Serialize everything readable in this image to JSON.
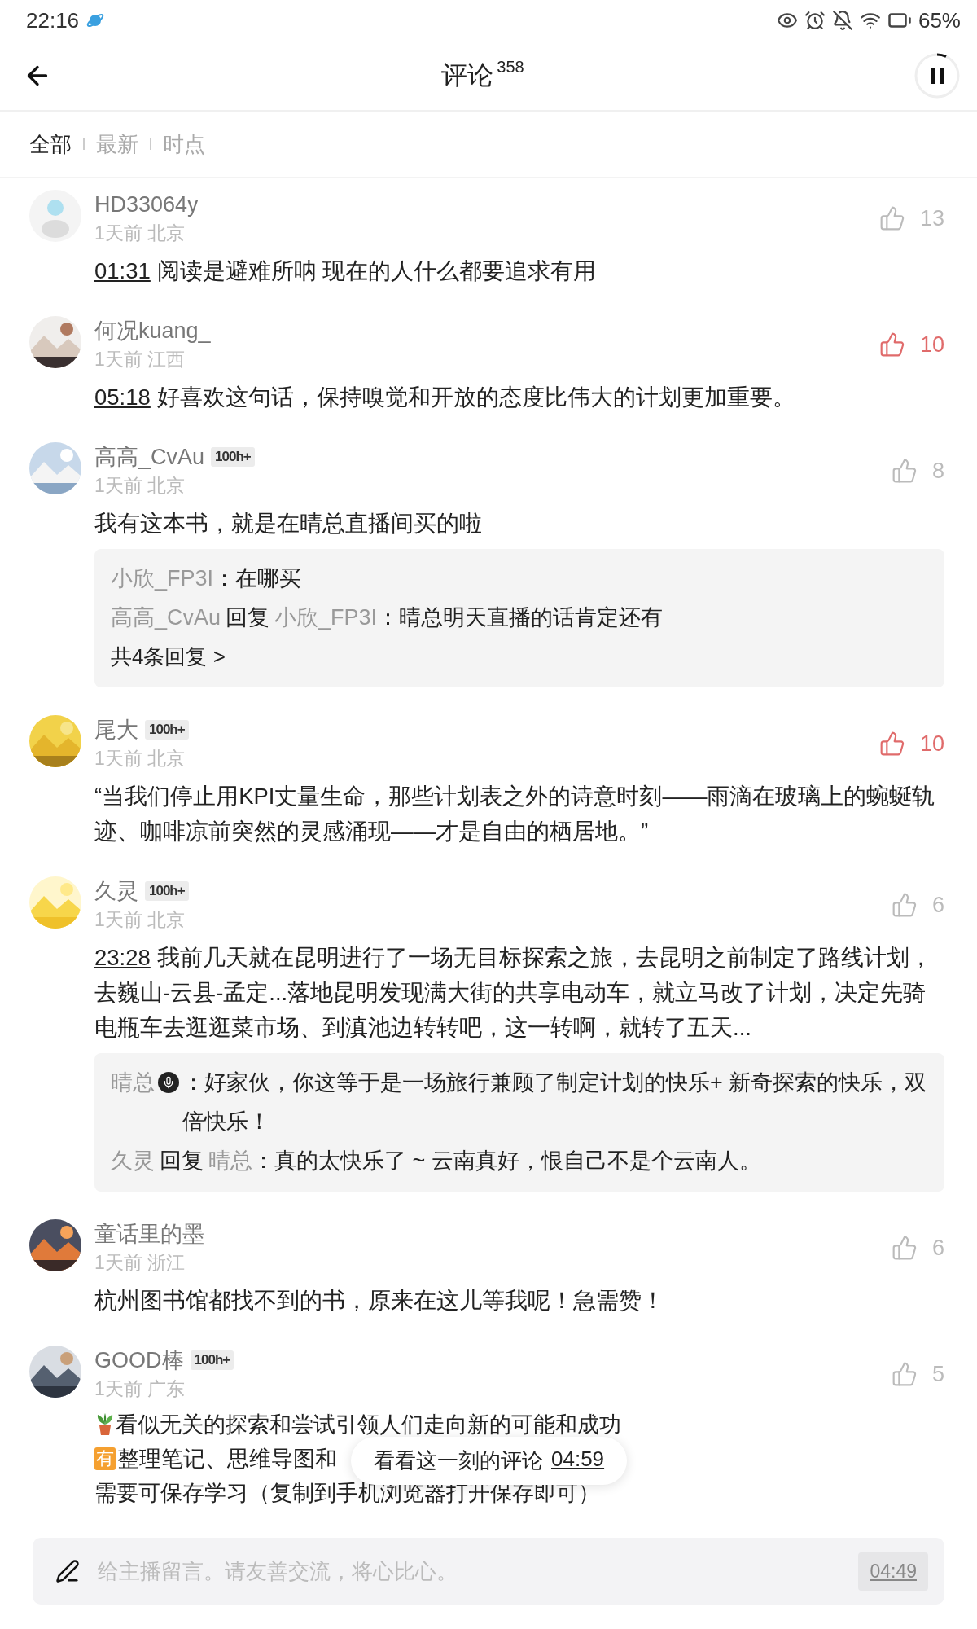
{
  "status_bar": {
    "time": "22:16",
    "battery": "65%"
  },
  "header": {
    "title": "评论",
    "count": "358"
  },
  "tabs": [
    {
      "label": "全部",
      "selected": true
    },
    {
      "label": "最新",
      "selected": false
    },
    {
      "label": "时点",
      "selected": false
    }
  ],
  "comments": [
    {
      "user": "HD33064y",
      "avatar": {
        "kind": "default"
      },
      "meta": "1天前 北京",
      "likes": "13",
      "liked": false,
      "timestamp": "01:31",
      "text": "阅读是避难所呐 现在的人什么都要追求有用"
    },
    {
      "user": "何况kuang_",
      "avatar": {
        "kind": "picture"
      },
      "meta": "1天前 江西",
      "likes": "10",
      "liked": true,
      "timestamp": "05:18",
      "text": "好喜欢这句话，保持嗅觉和开放的态度比伟大的计划更加重要。"
    },
    {
      "user": "高高_CvAu",
      "badge": "100h+",
      "avatar": {
        "kind": "picture"
      },
      "meta": "1天前 北京",
      "likes": "8",
      "liked": false,
      "text": "我有这本书，就是在晴总直播间买的啦",
      "replies": [
        {
          "author": "小欣_FP3I",
          "text": "：在哪买"
        },
        {
          "author": "高高_CvAu",
          "reply_word": "回复",
          "reply_to": "小欣_FP3I",
          "text": "：晴总明天直播的话肯定还有"
        }
      ],
      "more": "共4条回复 >"
    },
    {
      "user": "尾大",
      "badge": "100h+",
      "avatar": {
        "kind": "picture"
      },
      "meta": "1天前 北京",
      "likes": "10",
      "liked": true,
      "text": "“当我们停止用KPI丈量生命，那些计划表之外的诗意时刻——雨滴在玻璃上的蜿蜒轨迹、咖啡凉前突然的灵感涌现——才是自由的栖居地。”"
    },
    {
      "user": "久灵",
      "badge": "100h+",
      "avatar": {
        "kind": "picture"
      },
      "meta": "1天前 北京",
      "likes": "6",
      "liked": false,
      "timestamp": "23:28",
      "text": "我前几天就在昆明进行了一场无目标探索之旅，去昆明之前制定了路线计划，去巍山-云县-孟定...落地昆明发现满大街的共享电动车，就立马改了计划，决定先骑电瓶车去逛逛菜市场、到滇池边转转吧，这一转啊，就转了五天...",
      "replies": [
        {
          "author": "晴总",
          "mic": true,
          "text": "：好家伙，你这等于是一场旅行兼顾了制定计划的快乐+ 新奇探索的快乐，双倍快乐！"
        },
        {
          "author": "久灵",
          "reply_word": "回复",
          "reply_to": "晴总",
          "text": "：真的太快乐了 ~ 云南真好，恨自己不是个云南人。"
        }
      ]
    },
    {
      "user": "童话里的墨",
      "avatar": {
        "kind": "picture"
      },
      "meta": "1天前 浙江",
      "likes": "6",
      "liked": false,
      "text": "杭州图书馆都找不到的书，原来在这儿等我呢！急需赞！"
    },
    {
      "user": "GOOD棒",
      "badge": "100h+",
      "avatar": {
        "kind": "picture"
      },
      "meta": "1天前 广东",
      "likes": "5",
      "liked": false,
      "lines": [
        {
          "kind": "plant",
          "text": "看似无关的探索和尝试引领人们走向新的可能和成功"
        },
        {
          "kind": "tag",
          "tag": "有",
          "text": "整理笔记、思维导图和"
        },
        {
          "kind": "plain",
          "text": "需要可保存学习（复制到手机浏览器打开保存即可）"
        }
      ]
    }
  ],
  "toast": {
    "label": "看看这一刻的评论",
    "time": "04:59"
  },
  "composer": {
    "placeholder": "给主播留言。请友善交流，将心比心。",
    "time": "04:49"
  }
}
